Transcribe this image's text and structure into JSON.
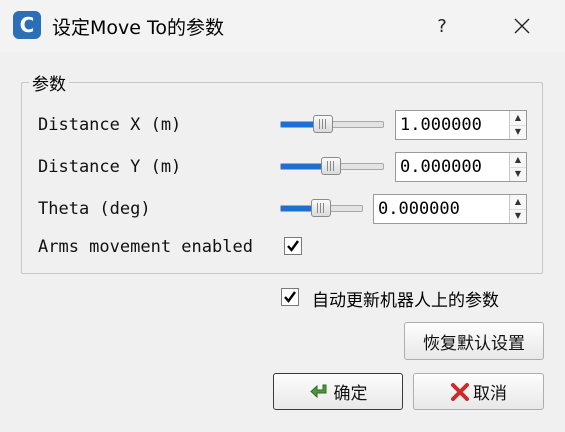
{
  "window": {
    "app_icon_letter": "C",
    "title": "设定Move To的参数",
    "help_label": "?"
  },
  "group": {
    "title": "参数",
    "params": [
      {
        "label": "Distance X (m)",
        "value": "1.000000",
        "slider_level": 0.45
      },
      {
        "label": "Distance Y (m)",
        "value": "0.000000",
        "slider_level": 0.5
      },
      {
        "label": "Theta (deg)",
        "value": "0.000000",
        "slider_level": 0.5
      }
    ],
    "arms_label": "Arms movement enabled",
    "arms_checked": true
  },
  "auto_update": {
    "label": "自动更新机器人上的参数",
    "checked": true
  },
  "buttons": {
    "restore": "恢复默认设置",
    "ok": "确定",
    "cancel": "取消"
  },
  "icons": {
    "app": "app-c-icon",
    "help": "help-icon",
    "close": "close-icon",
    "ok": "green-arrow-icon",
    "cancel": "red-x-icon"
  },
  "colors": {
    "slider_fill": "#1f6fd1",
    "app_icon": "#2c6fb7",
    "ok_icon": "#4a9a3a",
    "cancel_icon": "#cc2b2b"
  }
}
